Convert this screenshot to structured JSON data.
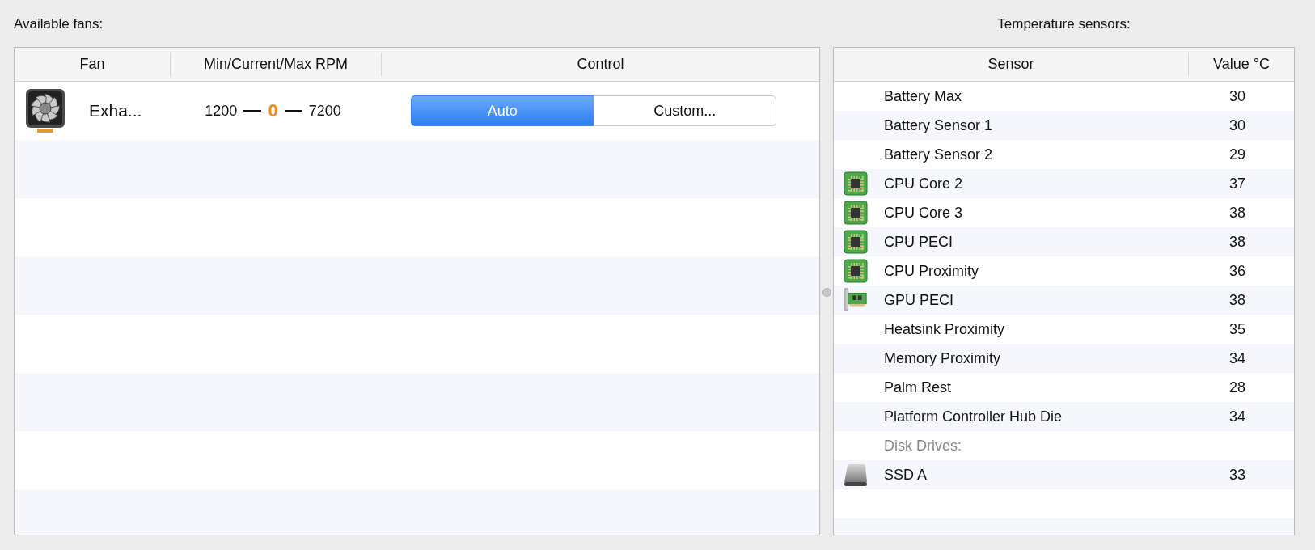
{
  "fans_panel": {
    "label": "Available fans:",
    "columns": [
      "Fan",
      "Min/Current/Max RPM",
      "Control"
    ],
    "rows": [
      {
        "name": "Exha...",
        "min": "1200",
        "current": "0",
        "max": "7200",
        "control": [
          {
            "label": "Auto",
            "selected": true
          },
          {
            "label": "Custom...",
            "selected": false
          }
        ]
      }
    ]
  },
  "sensors_panel": {
    "label": "Temperature sensors:",
    "columns": [
      "Sensor",
      "Value °C"
    ],
    "rows": [
      {
        "kind": "plain",
        "name": "Battery Max",
        "value": "30"
      },
      {
        "kind": "plain",
        "name": "Battery Sensor 1",
        "value": "30"
      },
      {
        "kind": "plain",
        "name": "Battery Sensor 2",
        "value": "29"
      },
      {
        "kind": "cpu",
        "name": "CPU Core 2",
        "value": "37"
      },
      {
        "kind": "cpu",
        "name": "CPU Core 3",
        "value": "38"
      },
      {
        "kind": "cpu",
        "name": "CPU PECI",
        "value": "38"
      },
      {
        "kind": "cpu",
        "name": "CPU Proximity",
        "value": "36"
      },
      {
        "kind": "gpu",
        "name": "GPU PECI",
        "value": "38"
      },
      {
        "kind": "plain",
        "name": "Heatsink Proximity",
        "value": "35"
      },
      {
        "kind": "plain",
        "name": "Memory Proximity",
        "value": "34"
      },
      {
        "kind": "plain",
        "name": "Palm Rest",
        "value": "28"
      },
      {
        "kind": "plain",
        "name": "Platform Controller Hub Die",
        "value": "34"
      },
      {
        "kind": "group",
        "name": "Disk Drives:"
      },
      {
        "kind": "disk",
        "name": "SSD A",
        "value": "33"
      }
    ]
  }
}
